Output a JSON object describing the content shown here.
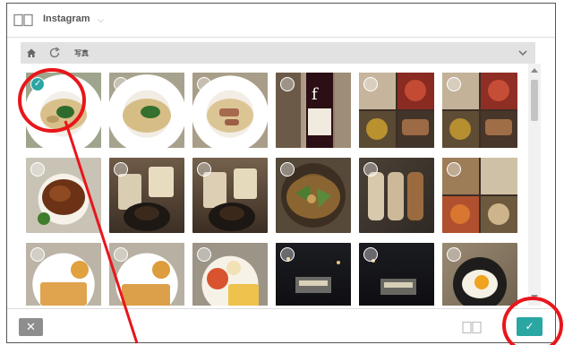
{
  "header": {
    "app_icon": "book-icon",
    "title": "Instagram",
    "caret": "⌵"
  },
  "pathbar": {
    "home_icon": "home-icon",
    "refresh_icon": "refresh-icon",
    "path": "写真",
    "chevron_icon": "chevron-down-icon"
  },
  "colors": {
    "accent": "#2aa6a3",
    "close_button": "#8e8e8e",
    "annotation_red": "#e8161b"
  },
  "photos": [
    {
      "name": "pasta",
      "selected": true
    },
    {
      "name": "pasta",
      "selected": false
    },
    {
      "name": "pasta",
      "selected": false
    },
    {
      "name": "wine-bottle",
      "selected": false
    },
    {
      "name": "collage",
      "selected": false
    },
    {
      "name": "collage",
      "selected": false
    },
    {
      "name": "grilled-meat",
      "selected": false
    },
    {
      "name": "beer-glasses",
      "selected": false
    },
    {
      "name": "beer-glasses",
      "selected": false
    },
    {
      "name": "stew",
      "selected": false
    },
    {
      "name": "skewers",
      "selected": false
    },
    {
      "name": "collage",
      "selected": false
    },
    {
      "name": "toast",
      "selected": false
    },
    {
      "name": "toast",
      "selected": false
    },
    {
      "name": "breakfast-plate",
      "selected": false
    },
    {
      "name": "night-scene",
      "selected": false
    },
    {
      "name": "night-scene",
      "selected": false
    },
    {
      "name": "fried-egg-pan",
      "selected": false
    }
  ],
  "footer": {
    "close_label": "✕",
    "icon": "book-icon",
    "confirm_label": "✓"
  }
}
